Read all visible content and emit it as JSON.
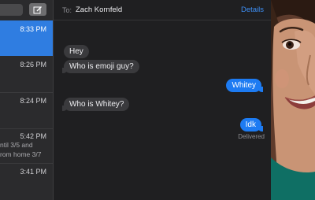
{
  "sidebar": {
    "rows": [
      {
        "time": "8:33 PM",
        "snippet": "",
        "active": true
      },
      {
        "time": "8:26 PM",
        "snippet": ""
      },
      {
        "time": "8:24 PM",
        "snippet": ""
      },
      {
        "time": "5:42 PM",
        "snippet": "ntil 3/5 and",
        "snippet2": "rom home 3/7"
      },
      {
        "time": "3:41 PM",
        "snippet": ""
      }
    ]
  },
  "header": {
    "to_label": "To:",
    "recipient": "Zach Kornfeld",
    "details_label": "Details"
  },
  "messages": [
    {
      "text": "Hey",
      "direction": "incoming"
    },
    {
      "text": "Who is emoji guy?",
      "direction": "incoming"
    },
    {
      "text": "Whitey",
      "direction": "outgoing"
    },
    {
      "text": "Who is Whitey?",
      "direction": "incoming"
    },
    {
      "text": "Idk",
      "direction": "outgoing"
    }
  ],
  "status": {
    "delivered": "Delivered"
  },
  "colors": {
    "accent": "#1d7bf2",
    "link": "#3d8ff5",
    "incoming_bubble": "#3a3a3d",
    "background": "#1f1f21"
  },
  "icons": {
    "compose": "compose-icon"
  }
}
